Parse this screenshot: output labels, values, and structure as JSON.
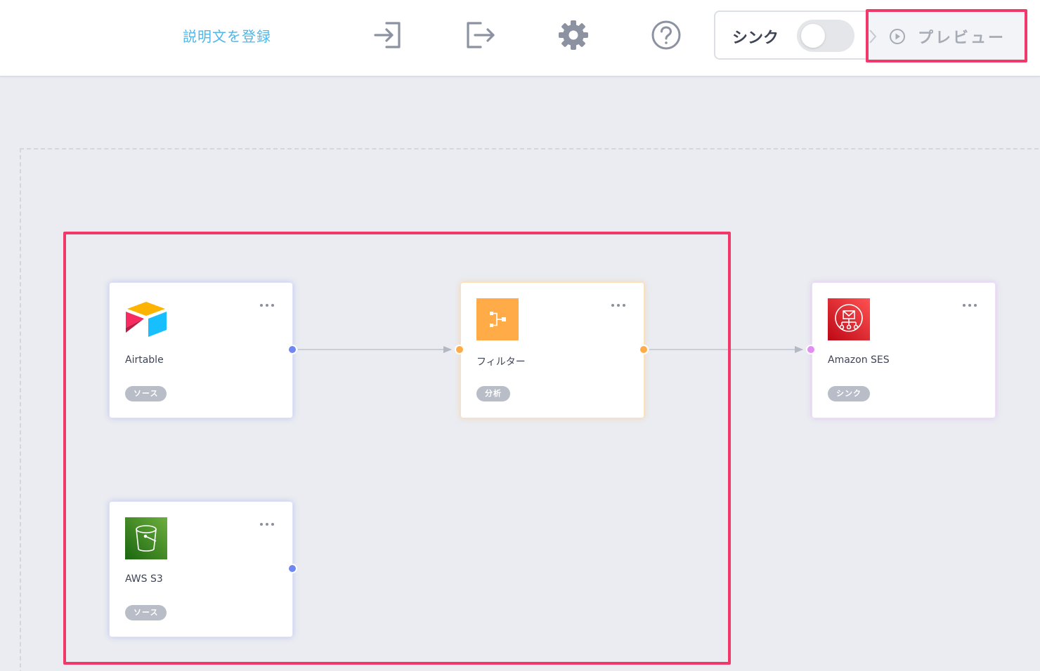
{
  "header": {
    "description_link": "説明文を登録",
    "icons": [
      "import-icon",
      "export-icon",
      "gear-icon",
      "help-icon"
    ],
    "sync": {
      "label": "シンク",
      "enabled": false
    },
    "preview": {
      "label": "プレビュー"
    }
  },
  "nodes": [
    {
      "id": "airtable",
      "title": "Airtable",
      "badge": "ソース",
      "kind": "source",
      "logo": "airtable-logo"
    },
    {
      "id": "filter",
      "title": "フィルター",
      "badge": "分析",
      "kind": "analysis",
      "logo": "filter-icon"
    },
    {
      "id": "ses",
      "title": "Amazon SES",
      "badge": "シンク",
      "kind": "sink",
      "logo": "amazon-ses-logo"
    },
    {
      "id": "s3",
      "title": "AWS S3",
      "badge": "ソース",
      "kind": "source",
      "logo": "aws-s3-logo"
    }
  ],
  "colors": {
    "accent_link": "#4fb7e8",
    "highlight": "#f1386a",
    "port_source": "#6f86f3",
    "port_analysis": "#ffac48",
    "port_sink": "#e38cf3",
    "filter_logo": "#ffac48",
    "ses_logo": "#d8232a",
    "s3_logo": "#3f8624"
  }
}
